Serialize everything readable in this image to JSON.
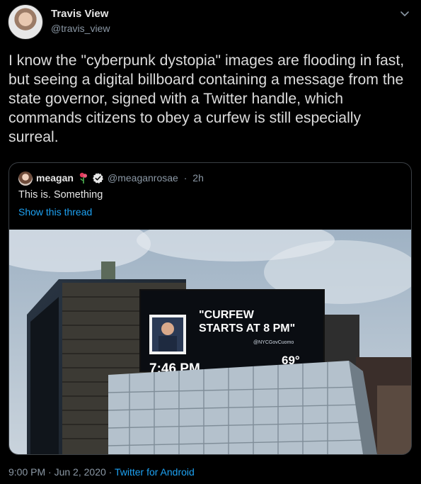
{
  "author": {
    "name": "Travis View",
    "handle": "@travis_view"
  },
  "tweet": {
    "text": "I know the \"cyberpunk dystopia\" images are flooding in fast, but seeing a digital billboard containing a message from the state governor, signed with a Twitter handle, which commands citizens to obey a curfew is still especially surreal."
  },
  "quoted": {
    "name": "meagan",
    "handle": "@meaganrosae",
    "separator": "·",
    "time": "2h",
    "text": "This is. Something",
    "thread_link": "Show this thread",
    "billboard": {
      "line1": "\"CURFEW",
      "line2": "STARTS AT 8 PM\"",
      "signature": "@NYCGovCuomo",
      "time": "7:46 PM",
      "temp": "69°"
    }
  },
  "footer": {
    "time": "9:00 PM",
    "sep1": "·",
    "date": "Jun 2, 2020",
    "sep2": "·",
    "source": "Twitter for Android"
  },
  "colors": {
    "background": "#000000",
    "link": "#1da1f2",
    "secondary_text": "#8b98a5",
    "verified": "#e6e6e6"
  },
  "icons": [
    "chevron-down-icon",
    "verified-badge-icon",
    "emoji-icon"
  ]
}
